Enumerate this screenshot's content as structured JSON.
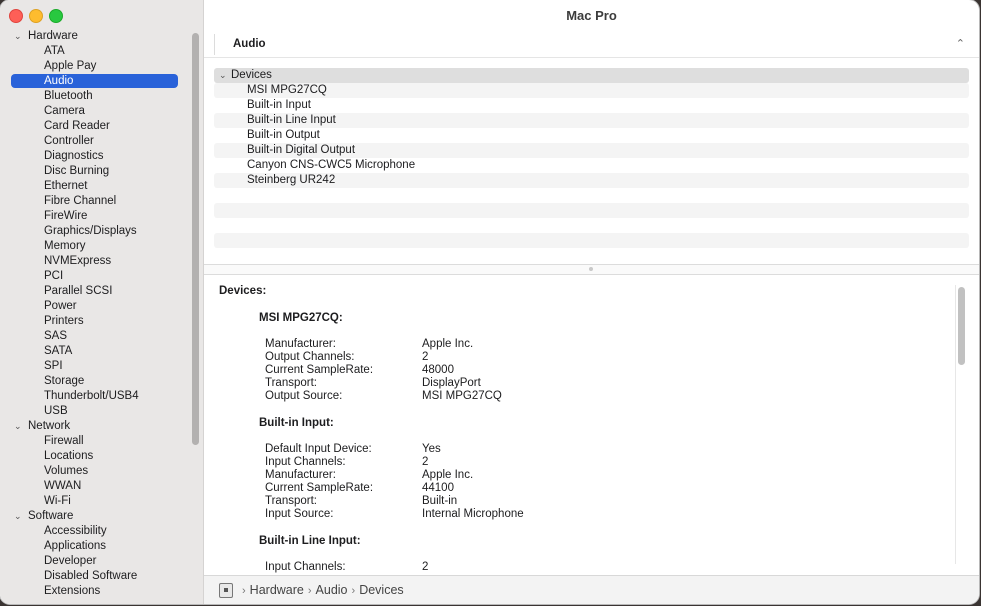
{
  "window": {
    "title": "Mac Pro"
  },
  "sidebar": {
    "groups": [
      {
        "label": "Hardware",
        "items": [
          "ATA",
          "Apple Pay",
          "Audio",
          "Bluetooth",
          "Camera",
          "Card Reader",
          "Controller",
          "Diagnostics",
          "Disc Burning",
          "Ethernet",
          "Fibre Channel",
          "FireWire",
          "Graphics/Displays",
          "Memory",
          "NVMExpress",
          "PCI",
          "Parallel SCSI",
          "Power",
          "Printers",
          "SAS",
          "SATA",
          "SPI",
          "Storage",
          "Thunderbolt/USB4",
          "USB"
        ]
      },
      {
        "label": "Network",
        "items": [
          "Firewall",
          "Locations",
          "Volumes",
          "WWAN",
          "Wi-Fi"
        ]
      },
      {
        "label": "Software",
        "items": [
          "Accessibility",
          "Applications",
          "Developer",
          "Disabled Software",
          "Extensions"
        ]
      }
    ],
    "selected": "Audio"
  },
  "section": {
    "name": "Audio",
    "collapse_icon": "chevron-up-icon"
  },
  "tree": {
    "head": "Devices",
    "items": [
      "MSI MPG27CQ",
      "Built-in Input",
      "Built-in Line Input",
      "Built-in Output",
      "Built-in Digital Output",
      "Canyon CNS-CWC5 Microphone",
      "Steinberg UR242"
    ]
  },
  "detail": {
    "title": "Devices:",
    "devices": [
      {
        "name": "MSI MPG27CQ:",
        "props": [
          {
            "k": "Manufacturer:",
            "v": "Apple Inc."
          },
          {
            "k": "Output Channels:",
            "v": "2"
          },
          {
            "k": "Current SampleRate:",
            "v": "48000"
          },
          {
            "k": "Transport:",
            "v": "DisplayPort"
          },
          {
            "k": "Output Source:",
            "v": "MSI MPG27CQ"
          }
        ]
      },
      {
        "name": "Built-in Input:",
        "props": [
          {
            "k": "Default Input Device:",
            "v": "Yes"
          },
          {
            "k": "Input Channels:",
            "v": "2"
          },
          {
            "k": "Manufacturer:",
            "v": "Apple Inc."
          },
          {
            "k": "Current SampleRate:",
            "v": "44100"
          },
          {
            "k": "Transport:",
            "v": "Built-in"
          },
          {
            "k": "Input Source:",
            "v": "Internal Microphone"
          }
        ]
      },
      {
        "name": "Built-in Line Input:",
        "props": [
          {
            "k": "Input Channels:",
            "v": "2"
          }
        ]
      }
    ]
  },
  "footer": {
    "breadcrumb": [
      "Hardware",
      "Audio",
      "Devices"
    ]
  }
}
